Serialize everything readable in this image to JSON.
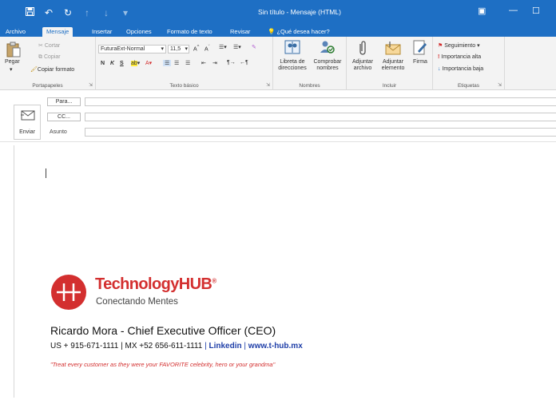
{
  "titlebar": {
    "title": "Sin título - Mensaje (HTML)",
    "save_icon": "save-icon",
    "undo_icon": "undo-icon",
    "redo_icon": "redo-icon"
  },
  "tabs": [
    {
      "label": "Archivo"
    },
    {
      "label": "Mensaje"
    },
    {
      "label": "Insertar"
    },
    {
      "label": "Opciones"
    },
    {
      "label": "Formato de texto"
    },
    {
      "label": "Revisar"
    },
    {
      "label": "¿Qué desea hacer?"
    }
  ],
  "ribbon": {
    "clipboard": {
      "paste": "Pegar",
      "cut": "Cortar",
      "copy": "Copiar",
      "format_painter": "Copiar formato",
      "label": "Portapapeles"
    },
    "basic_text": {
      "font": "FuturaExt-Normal",
      "size": "11,5",
      "label": "Texto básico"
    },
    "names": {
      "address_book": "Libreta de direcciones",
      "check_names": "Comprobar nombres",
      "label": "Nombres"
    },
    "include": {
      "attach_file": "Adjuntar archivo",
      "attach_item": "Adjuntar elemento",
      "signature": "Firma",
      "label": "Incluir"
    },
    "tags": {
      "followup": "Seguimiento",
      "high": "Importancia alta",
      "low": "Importancia baja",
      "label": "Etiquetas"
    }
  },
  "header": {
    "send": "Enviar",
    "to": "Para...",
    "cc": "CC...",
    "subject": "Asunto"
  },
  "signature": {
    "brand_technology": "Technology",
    "brand_hub": "HUB",
    "brand_reg": "®",
    "tagline": "Conectando Mentes",
    "name": "Ricardo Mora - Chief Executive Officer (CEO)",
    "contact_phones": "US + 915-671-1111 | MX +52 656-611-1111",
    "sep1": "|",
    "linkedin": "Linkedin",
    "sep2": "|",
    "website": "www.t-hub.mx",
    "quote": "\"Treat every customer as they were your FAVORITE celebrity, hero or your grandma\"",
    "brand_color": "#d32f2f",
    "link_color": "#1f3fa8"
  },
  "colors": {
    "accent": "#1e6fc4",
    "ribbon_bg": "#f3f3f3"
  }
}
